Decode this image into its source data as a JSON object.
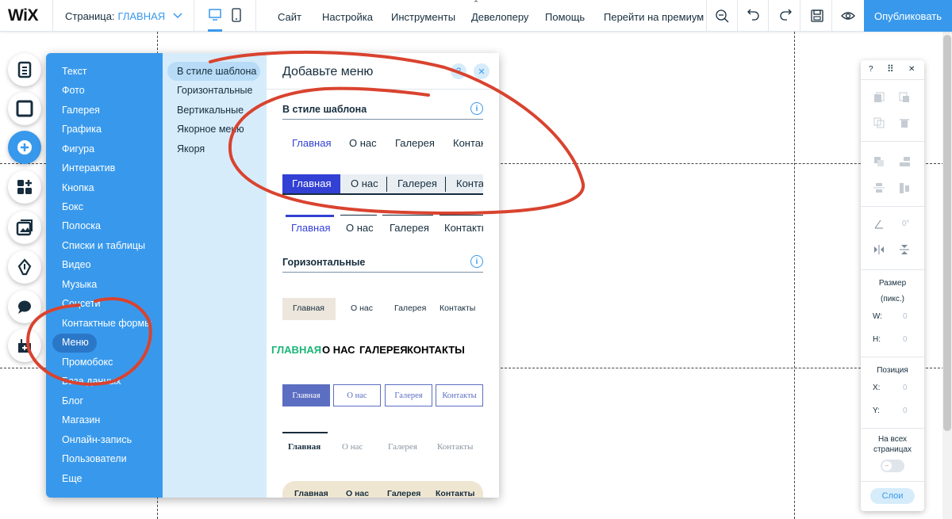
{
  "topbar": {
    "logo": "WiX",
    "page_label": "Страница:",
    "page_name": "ГЛАВНАЯ",
    "nav": [
      "Сайт",
      "Настройка",
      "Инструменты",
      "Девелоперу",
      "Помощь",
      "Перейти на премиум"
    ],
    "publish": "Опубликовать",
    "collapse_glyph": "⌃"
  },
  "add_panel": {
    "categories": [
      "Текст",
      "Фото",
      "Галерея",
      "Графика",
      "Фигура",
      "Интерактив",
      "Кнопка",
      "Бокс",
      "Полоска",
      "Списки и таблицы",
      "Видео",
      "Музыка",
      "Соцсети",
      "Контактные формы",
      "Меню",
      "Промобокс",
      "База данных",
      "Блог",
      "Магазин",
      "Онлайн-запись",
      "Пользователи",
      "Еще"
    ],
    "subcategories": [
      "В стиле шаблона",
      "Горизонтальные",
      "Вертикальные",
      "Якорное меню",
      "Якоря"
    ],
    "title": "Добавьте меню",
    "help": "?",
    "close": "✕",
    "section1": "В стиле шаблона",
    "section2": "Горизонтальные",
    "info_glyph": "i",
    "menu_items": [
      "Главная",
      "О нас",
      "Галерея",
      "Контакты"
    ],
    "menu_items_caps": [
      "ГЛАВНАЯ",
      "О НАС",
      "ГАЛЕРЕЯ",
      "КОНТАКТЫ"
    ]
  },
  "right_panel": {
    "help": "?",
    "drag": "⠿",
    "close": "✕",
    "rotation": "0°",
    "size_label": "Размер",
    "size_unit": "(пикс.)",
    "w_label": "W:",
    "w_value": "0",
    "h_label": "H:",
    "h_value": "0",
    "position_label": "Позиция",
    "x_label": "X:",
    "x_value": "0",
    "y_label": "Y:",
    "y_value": "0",
    "all_pages": "На всех страницах",
    "layers": "Слои"
  },
  "colors": {
    "accent": "#3899ec",
    "accent_dark": "#2b77c7",
    "light_blue": "#d6ecfb",
    "annotation": "#d9432f",
    "menu_active": "#3240d4",
    "green_active": "#19b576"
  }
}
